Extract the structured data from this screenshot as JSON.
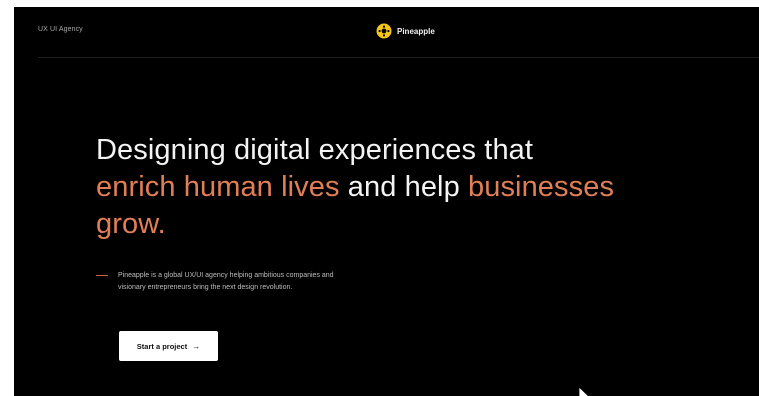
{
  "header": {
    "agency_label": "UX UI Agency",
    "brand_name": "Pineapple",
    "brand_icon": "pineapple-logo-icon",
    "brand_color": "#f5c518"
  },
  "hero": {
    "headline_part1": "Designing digital experiences that ",
    "headline_accent1": "enrich human lives",
    "headline_part2": " and help ",
    "headline_accent2": "businesses grow.",
    "accent_color": "#e07f57",
    "description": "Pineapple is a global UX/UI agency helping ambitious companies and visionary entrepreneurs bring the next design revolution.",
    "cta_label": "Start a project",
    "cta_icon": "arrow-right-icon"
  },
  "theme": {
    "background": "#000000",
    "text": "#f4f4f4"
  }
}
